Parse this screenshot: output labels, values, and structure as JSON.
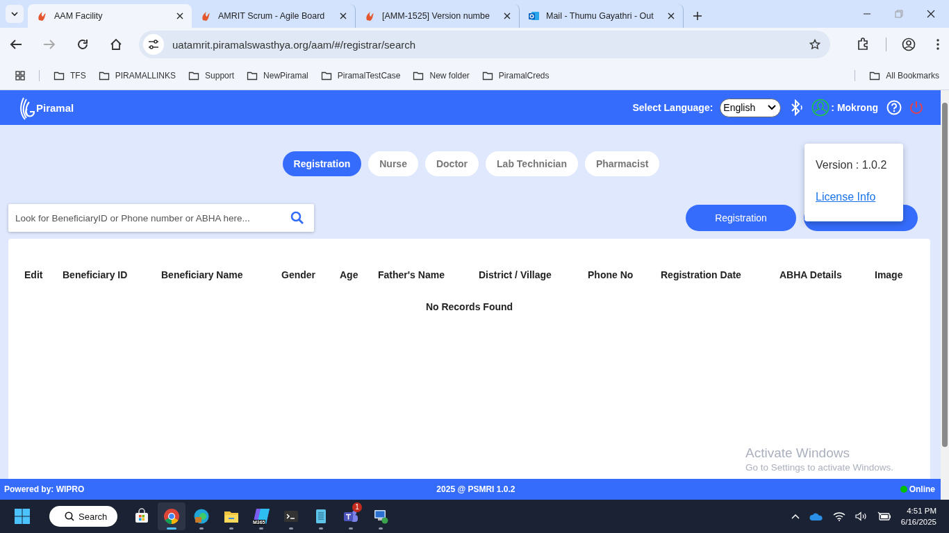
{
  "browser": {
    "tabs": [
      {
        "title": "AAM Facility",
        "kind": "app",
        "selected": true
      },
      {
        "title": "AMRIT Scrum - Agile Board",
        "kind": "app",
        "selected": false
      },
      {
        "title": "[AMM-1525] Version numbe",
        "kind": "app",
        "selected": false
      },
      {
        "title": "Mail - Thumu Gayathri - Out",
        "kind": "mail",
        "selected": false
      }
    ],
    "address": "uatamrit.piramalswasthya.org/aam/#/registrar/search",
    "bookmarks": [
      "TFS",
      "PIRAMALLINKS",
      "Support",
      "NewPiramal",
      "PiramalTestCase",
      "New folder",
      "PiramalCreds"
    ],
    "all_bookmarks": "All Bookmarks"
  },
  "header": {
    "brand": "Piramal",
    "language_label": "Select Language:",
    "language": "English",
    "user_separator": ":",
    "user": "Mokrong"
  },
  "role_tabs": [
    {
      "label": "Registration",
      "selected": true
    },
    {
      "label": "Nurse",
      "selected": false
    },
    {
      "label": "Doctor",
      "selected": false
    },
    {
      "label": "Lab Technician",
      "selected": false
    },
    {
      "label": "Pharmacist",
      "selected": false
    }
  ],
  "search": {
    "placeholder": "Look for BeneficiaryID or Phone number or ABHA here..."
  },
  "actions": {
    "registration": "Registration"
  },
  "popup": {
    "version": "Version : 1.0.2",
    "link": "License Info"
  },
  "table": {
    "columns": [
      "Edit",
      "Beneficiary ID",
      "Beneficiary Name",
      "Gender",
      "Age",
      "Father's Name",
      "District / Village",
      "Phone No",
      "Registration Date",
      "ABHA Details",
      "Image"
    ],
    "empty": "No Records Found"
  },
  "os_watermark": {
    "title": "Activate Windows",
    "text": "Go to Settings to activate Windows."
  },
  "footer": {
    "left": "Powered by: WIPRO",
    "center": "2025 @ PSMRI 1.0.2",
    "status": "Online",
    "online": true
  },
  "taskbar": {
    "search": "Search",
    "apps": [
      {
        "kind": "store",
        "selected": false,
        "running": false
      },
      {
        "kind": "chrome",
        "selected": true,
        "running": true
      },
      {
        "kind": "edge",
        "selected": false,
        "running": true
      },
      {
        "kind": "folder",
        "selected": false,
        "running": true
      },
      {
        "kind": "m365",
        "label": "M365",
        "selected": false,
        "running": true
      },
      {
        "kind": "terminal",
        "selected": false,
        "running": true
      },
      {
        "kind": "notepad",
        "selected": false,
        "running": true
      },
      {
        "kind": "teams",
        "badge": "1",
        "selected": false,
        "running": true
      },
      {
        "kind": "remote",
        "selected": false,
        "running": true
      }
    ],
    "time": "4:51 PM",
    "date": "6/16/2025"
  }
}
